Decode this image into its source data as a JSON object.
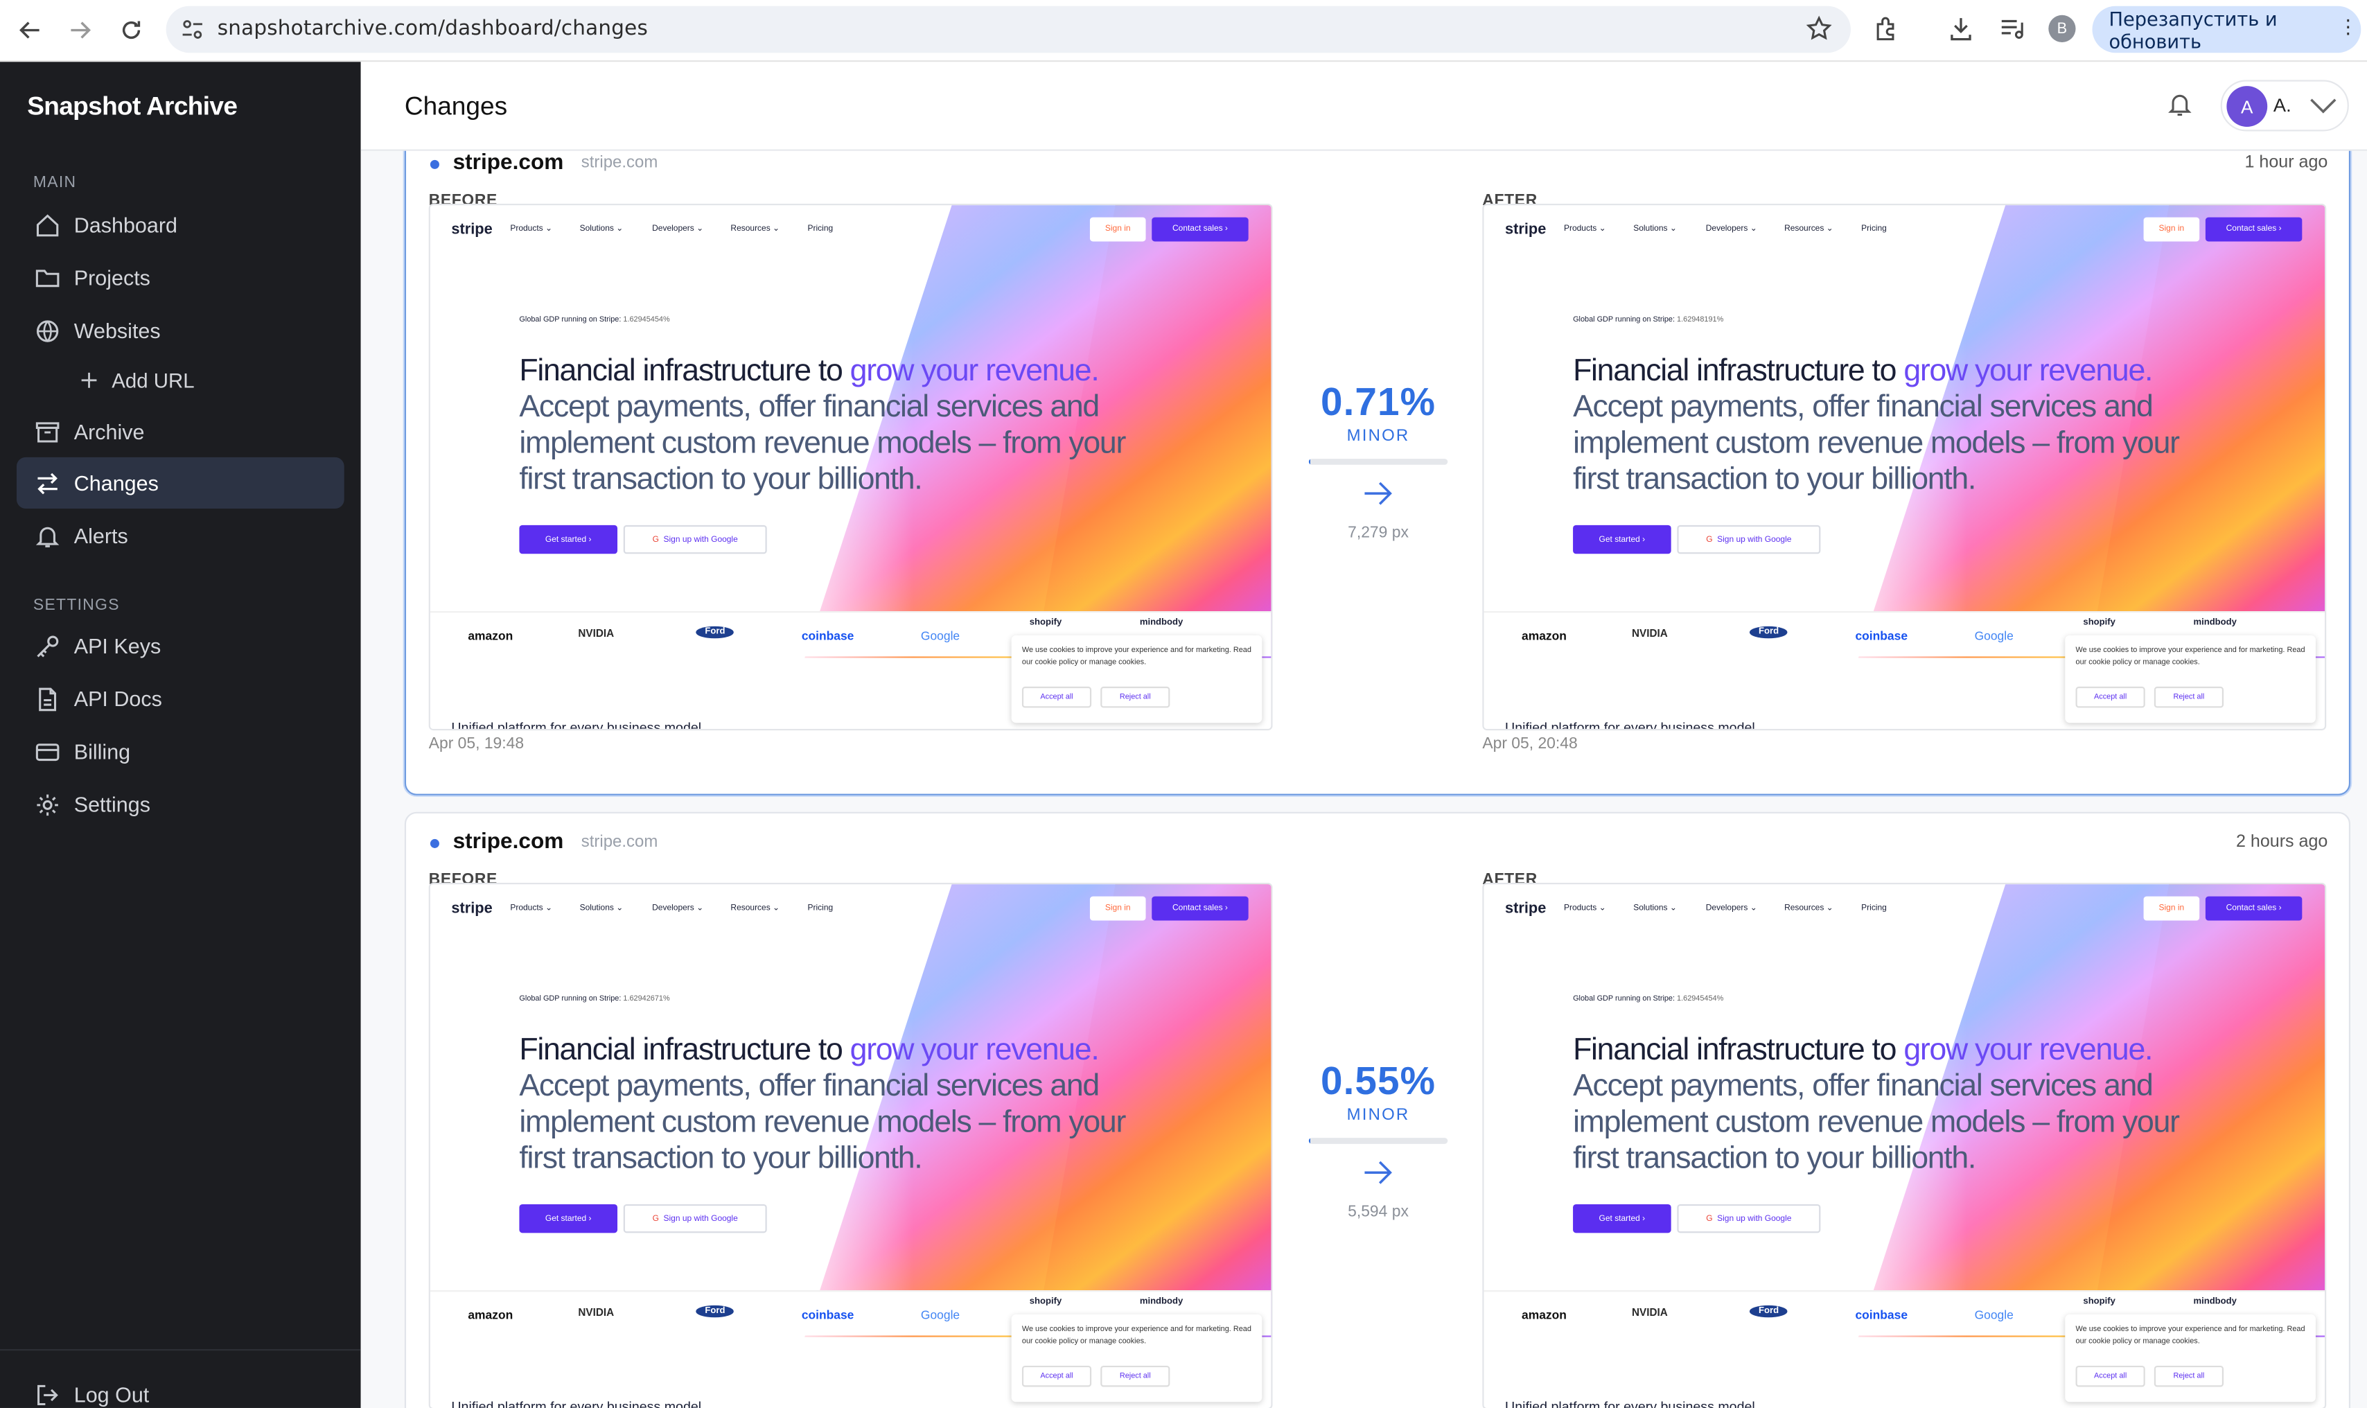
{
  "browser": {
    "url": "snapshotarchive.com/dashboard/changes",
    "profile_initial": "B",
    "relaunch_label": "Перезапустить и обновить"
  },
  "sidebar": {
    "brand": "Snapshot Archive",
    "main_section": "MAIN",
    "settings_section": "SETTINGS",
    "items": [
      {
        "label": "Dashboard",
        "icon": "home-icon"
      },
      {
        "label": "Projects",
        "icon": "folder-icon"
      },
      {
        "label": "Websites",
        "icon": "globe-icon"
      },
      {
        "label": "Add URL",
        "icon": "plus-icon"
      },
      {
        "label": "Archive",
        "icon": "archive-icon"
      },
      {
        "label": "Changes",
        "icon": "swap-icon",
        "active": true
      },
      {
        "label": "Alerts",
        "icon": "bell-icon"
      },
      {
        "label": "API Keys",
        "icon": "key-icon"
      },
      {
        "label": "API Docs",
        "icon": "document-icon"
      },
      {
        "label": "Billing",
        "icon": "credit-card-icon"
      },
      {
        "label": "Settings",
        "icon": "gear-icon"
      },
      {
        "label": "Log Out",
        "icon": "logout-icon"
      }
    ]
  },
  "header": {
    "title": "Changes",
    "user_initial": "A",
    "user_name": "A."
  },
  "snapshot": {
    "brand": "stripe",
    "menu": [
      "Products ⌄",
      "Solutions ⌄",
      "Developers ⌄",
      "Resources ⌄",
      "Pricing"
    ],
    "signin": "Sign in",
    "contact": "Contact sales ›",
    "gdp_label": "Global GDP running on Stripe:",
    "headline_a": "Financial infrastructure to ",
    "headline_b": "grow your revenue.",
    "headline_c": " Accept payments, offer financial services and implement custom revenue models – from your first transaction to your billionth.",
    "cta": "Get started ›",
    "google": "Sign up with Google",
    "logos": [
      "amazon",
      "NVIDIA",
      "Ford",
      "coinbase",
      "Google",
      "shopify",
      "mindbody"
    ],
    "cookie_text": "We use cookies to improve your experience and for marketing. Read our cookie policy or manage cookies.",
    "accept": "Accept all",
    "reject": "Reject all",
    "footer_text": "Unified platform for every business model"
  },
  "changes": [
    {
      "site": "stripe.com",
      "host": "stripe.com",
      "ago": "1 hour ago",
      "before_label": "BEFORE",
      "after_label": "AFTER",
      "before_gdp": "1.62945454%",
      "after_gdp": "1.62948191%",
      "before_time": "Apr 05, 19:48",
      "after_time": "Apr 05, 20:48",
      "diff_percent": "0.71%",
      "diff_level": "MINOR",
      "diff_fraction": 0.0071,
      "diff_pixels": "7,279 px"
    },
    {
      "site": "stripe.com",
      "host": "stripe.com",
      "ago": "2 hours ago",
      "before_label": "BEFORE",
      "after_label": "AFTER",
      "before_gdp": "1.62942671%",
      "after_gdp": "1.62945454%",
      "before_time": "",
      "after_time": "",
      "diff_percent": "0.55%",
      "diff_level": "MINOR",
      "diff_fraction": 0.0055,
      "diff_pixels": "5,594 px"
    }
  ],
  "colors": {
    "sidebar_bg": "#1c1d21",
    "accent": "#2f6fe0",
    "stripe_purple": "#5b2ef0"
  }
}
